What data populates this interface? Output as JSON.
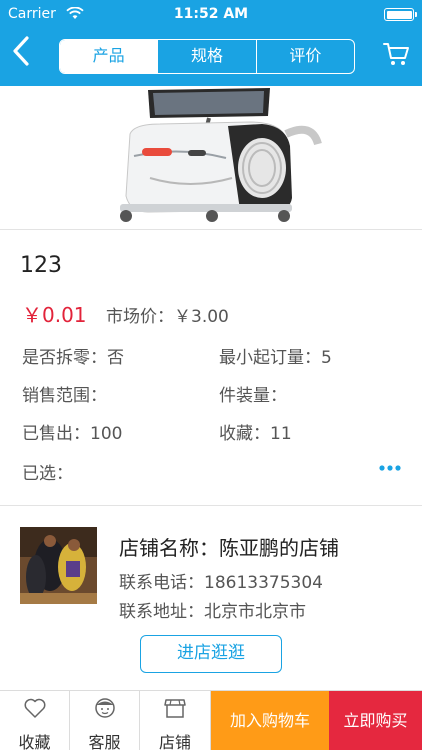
{
  "status_bar": {
    "carrier": "Carrier",
    "time": "11:52 AM"
  },
  "nav": {
    "tabs": [
      {
        "label": "产品",
        "active": true
      },
      {
        "label": "规格",
        "active": false
      },
      {
        "label": "评价",
        "active": false
      }
    ],
    "back_icon": "chevron-left-icon",
    "cart_icon": "cart-icon"
  },
  "product": {
    "name": "123",
    "price": "￥0.01",
    "market_price_label": "市场价：",
    "market_price": "￥3.00",
    "split_label": "是否拆零：",
    "split_value": "否",
    "min_order_label": "最小起订量：",
    "min_order_value": "5",
    "sales_area_label": "销售范围：",
    "sales_area_value": "",
    "pack_label": "件装量：",
    "pack_value": "",
    "sold_label": "已售出：",
    "sold_value": "100",
    "fav_label": "收藏：",
    "fav_value": "11",
    "selected_label": "已选：",
    "selected_value": ""
  },
  "shop": {
    "name_label": "店铺名称：",
    "name": "陈亚鹏的店铺",
    "phone_label": "联系电话：",
    "phone": "18613375304",
    "address_label": "联系地址：",
    "address": "北京市北京市",
    "visit_button": "进店逛逛"
  },
  "bottom_bar": {
    "favorite": "收藏",
    "service": "客服",
    "store": "店铺",
    "add_to_cart": "加入购物车",
    "buy_now": "立即购买"
  },
  "colors": {
    "accent": "#1aa3e3",
    "price": "#e2233a",
    "cart_button": "#ff9b17",
    "buy_button": "#e5283f"
  }
}
